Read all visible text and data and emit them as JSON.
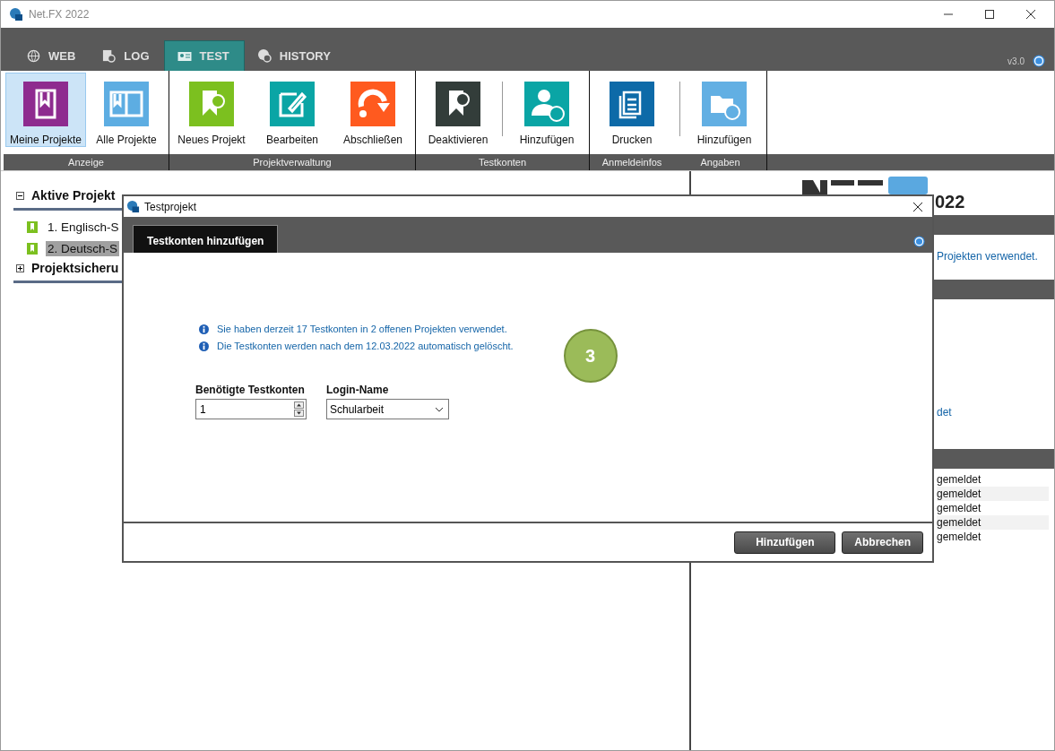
{
  "window": {
    "title": "Net.FX 2022"
  },
  "tabs": [
    {
      "label": "WEB",
      "kind": "globe",
      "selected": false
    },
    {
      "label": "LOG",
      "kind": "log",
      "selected": false
    },
    {
      "label": "TEST",
      "kind": "card",
      "selected": true
    },
    {
      "label": "HISTORY",
      "kind": "history",
      "selected": false
    }
  ],
  "version": "v3.0",
  "ribbon": [
    {
      "groups": [
        {
          "label": "Anzeige",
          "buttons": [
            {
              "label": "Meine Projekte",
              "kind": "bookmark",
              "color": "#8e2b8f",
              "selected": true,
              "divider_before": false
            },
            {
              "label": "Alle Projekte",
              "kind": "book",
              "color": "#5dade2",
              "selected": false,
              "divider_before": false
            }
          ]
        }
      ]
    },
    {
      "groups": [
        {
          "label": "Projektverwaltung",
          "buttons": [
            {
              "label": "Neues Projekt",
              "kind": "newbookmark",
              "color": "#7cc01f",
              "selected": false,
              "divider_before": false
            },
            {
              "label": "Bearbeiten",
              "kind": "edit",
              "color": "#0aa5a5",
              "selected": false,
              "divider_before": false
            },
            {
              "label": "Abschließen",
              "kind": "finish",
              "color": "#ff5a1f",
              "selected": false,
              "divider_before": false
            }
          ]
        }
      ]
    },
    {
      "groups": [
        {
          "label": "Testkonten",
          "buttons": [
            {
              "label": "Deaktivieren",
              "kind": "deactivate",
              "color": "#333d3a",
              "selected": false,
              "divider_before": false
            },
            {
              "label": "Hinzufügen",
              "kind": "adduser",
              "color": "#0aa5a5",
              "selected": false,
              "divider_before": true
            }
          ]
        }
      ]
    },
    {
      "groups": [
        {
          "label": "Anmeldeinfos",
          "buttons": [
            {
              "label": "Drucken",
              "kind": "print",
              "color": "#0d6aa8",
              "selected": false,
              "divider_before": false
            }
          ]
        },
        {
          "label": "Angaben",
          "buttons": [
            {
              "label": "Hinzufügen",
              "kind": "addfolder",
              "color": "#62afe3",
              "selected": false,
              "divider_before": true
            }
          ]
        }
      ]
    }
  ],
  "tree": [
    {
      "label": "Aktive Projekt",
      "expanded": true,
      "children": [
        {
          "label": "1. Englisch-S",
          "selected": false
        },
        {
          "label": "2. Deutsch-S",
          "selected": true
        }
      ]
    },
    {
      "label": "Projektsicheru",
      "expanded": false
    }
  ],
  "right_pane": {
    "logo_suffix": "022",
    "note_1": "Projekten verwendet.",
    "note_2": "det",
    "list": [
      "gemeldet",
      "gemeldet",
      "gemeldet",
      "gemeldet",
      "gemeldet"
    ]
  },
  "dialog": {
    "title": "Testprojekt",
    "tabs": [
      {
        "label": "Testkonten hinzufügen",
        "selected": true
      }
    ],
    "info": [
      "Sie haben derzeit 17 Testkonten in 2 offenen Projekten verwendet.",
      "Die Testkonten werden nach dem 12.03.2022 automatisch gelöscht."
    ],
    "step": "3",
    "count": {
      "label": "Benötigte Testkonten",
      "value": "1"
    },
    "login": {
      "label": "Login-Name",
      "value": "Schularbeit"
    },
    "buttons": [
      "Hinzufügen",
      "Abbrechen"
    ]
  }
}
